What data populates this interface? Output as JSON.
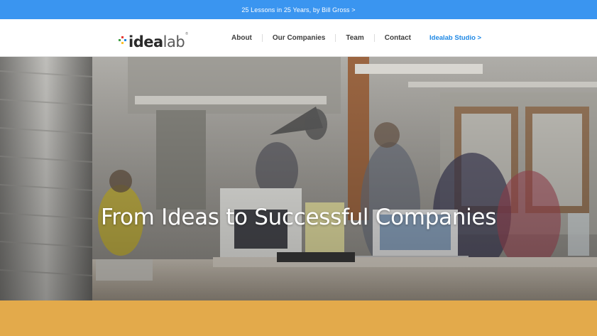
{
  "announcement": {
    "text": "25 Lessons in 25 Years, by Bill Gross >"
  },
  "logo": {
    "idea": "idea",
    "lab": "lab",
    "reg": "®"
  },
  "nav": {
    "items": [
      {
        "label": "About"
      },
      {
        "label": "Our Companies"
      },
      {
        "label": "Team"
      },
      {
        "label": "Contact"
      }
    ],
    "studio": "Idealab Studio >"
  },
  "hero": {
    "title": "From Ideas to Successful Companies"
  },
  "colors": {
    "announcement_bg": "#3a95f0",
    "studio_link": "#1e88e5",
    "band": "#e3aa4b",
    "logo_dots": [
      "#e53935",
      "#43a047",
      "#1e88e5",
      "#fbc02d"
    ]
  }
}
